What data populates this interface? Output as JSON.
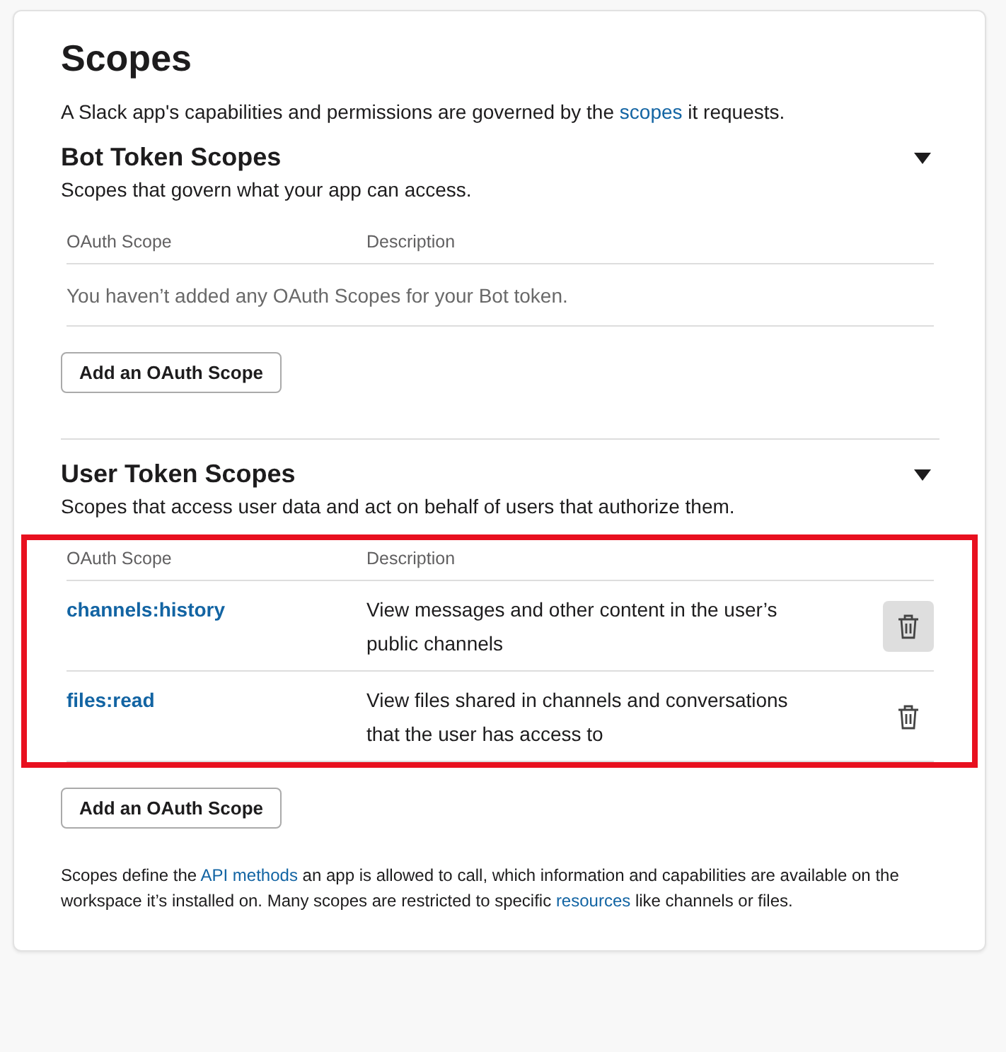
{
  "title": "Scopes",
  "intro": {
    "before": "A Slack app's capabilities and permissions are governed by the ",
    "link": "scopes",
    "after": " it requests."
  },
  "sections": [
    {
      "heading": "Bot Token Scopes",
      "subtitle": "Scopes that govern what your app can access.",
      "expanded": true,
      "highlighted": false,
      "columns": [
        "OAuth Scope",
        "Description"
      ],
      "empty_message": "You haven’t added any OAuth Scopes for your Bot token.",
      "add_button": "Add an OAuth Scope"
    },
    {
      "heading": "User Token Scopes",
      "subtitle": "Scopes that access user data and act on behalf of users that authorize them.",
      "expanded": true,
      "highlighted": true,
      "columns": [
        "OAuth Scope",
        "Description"
      ],
      "rows": [
        {
          "scope": "channels:history",
          "description": "View messages and other content in the user’s public channels",
          "hovered": true
        },
        {
          "scope": "files:read",
          "description": "View files shared in channels and conversations that the user has access to",
          "hovered": false
        }
      ],
      "add_button": "Add an OAuth Scope"
    }
  ],
  "footer": [
    {
      "kind": "text",
      "text": "Scopes define the "
    },
    {
      "kind": "link",
      "text": "API methods"
    },
    {
      "kind": "text",
      "text": " an app is allowed to call, which information and capabilities are available on the workspace it’s installed on. Many scopes are restricted to specific "
    },
    {
      "kind": "link",
      "text": "resources"
    },
    {
      "kind": "text",
      "text": " like channels or files."
    }
  ]
}
